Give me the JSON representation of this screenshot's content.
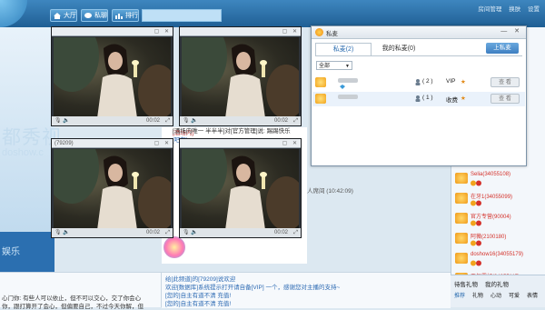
{
  "topbar": {
    "tabs": [
      {
        "label": "大厅"
      },
      {
        "label": "私聊"
      },
      {
        "label": "排行"
      }
    ],
    "links": [
      "房间管理",
      "换肤",
      "设置"
    ]
  },
  "brand": {
    "text": "都秀视",
    "domain": "doshow.c",
    "live": "娱乐"
  },
  "videos": [
    {
      "title": "",
      "time": "00:02"
    },
    {
      "title": "",
      "time": "00:02"
    },
    {
      "title": "(79209)",
      "time": "00:02"
    },
    {
      "title": "",
      "time": "00:02"
    }
  ],
  "chat": {
    "lines": [
      "[酒场内]",
      "[吧友]",
      "[酒场内唯一 半半半]对[官方管理]说: 踢踢快乐",
      "人席间 (10:42:09)"
    ]
  },
  "bottom_chat": {
    "lines": [
      "给[此频道]的[79209]说欢迎",
      "欢迎[数据库]系统提示打开请自备[VIP] 一个，感谢您对主播的支持~",
      "[您的]自主有道不清 充值!",
      "[您的]自主有道不清 充值!"
    ]
  },
  "left_chat": {
    "lines": [
      "心门你: 有些人可以依止，但不可以交心，交了你会心",
      "你，跟打算开了会心，但偏要自己，不过今天你解，但"
    ]
  },
  "users": [
    {
      "name": "Selia(34055108)"
    },
    {
      "name": "在牙1(34055099)"
    },
    {
      "name": "官方专营(90004)"
    },
    {
      "name": "阿薇(2100180)"
    },
    {
      "name": "doshow16(34055179)"
    },
    {
      "name": "天气霸好(34055117)"
    }
  ],
  "gift_bar": {
    "tabs": [
      "待售礼物",
      "我的礼物"
    ],
    "tools": [
      "推荐",
      "礼物",
      "心动",
      "可爱",
      "表情"
    ]
  },
  "pm": {
    "title": "私麦",
    "tabs": [
      "私麦(2)",
      "我的私麦(0)"
    ],
    "up_button": "上私麦",
    "filter": "全部",
    "rows": [
      {
        "count": "( 2 )",
        "level": "VIP",
        "button": "查 看"
      },
      {
        "count": "( 1 )",
        "level": "收费",
        "button": "查 看"
      }
    ]
  },
  "colors": {
    "accent": "#2f77b3",
    "name_red": "#d4322b",
    "tab_blue": "#2c6db0"
  }
}
